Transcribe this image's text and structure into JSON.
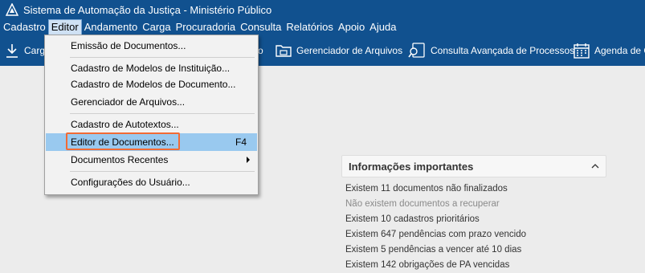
{
  "window": {
    "title": "Sistema de Automação da Justiça - Ministério Público"
  },
  "menu": [
    "Cadastro",
    "Editor",
    "Andamento",
    "Carga",
    "Procuradoria",
    "Consulta",
    "Relatórios",
    "Apoio",
    "Ajuda"
  ],
  "toolbar": {
    "carga": "Carga",
    "hidden_suffix": "o",
    "gerenciador": "Gerenciador de Arquivos",
    "consulta": "Consulta Avançada de Processos",
    "agenda": "Agenda de C"
  },
  "editor_menu": {
    "emissao": "Emissão de Documentos...",
    "modelos_instituicao": "Cadastro de Modelos de Instituição...",
    "modelos_documento": "Cadastro de Modelos de Documento...",
    "gerenciador": "Gerenciador de Arquivos...",
    "autotextos": "Cadastro de Autotextos...",
    "editor_documentos": "Editor de Documentos...",
    "editor_shortcut": "F4",
    "recentes": "Documentos Recentes",
    "configuracoes": "Configurações do Usuário..."
  },
  "info_panel": {
    "title": "Informações importantes",
    "lines": [
      "Existem 11 documentos não finalizados",
      "Não existem documentos a recuperar",
      "Existem 10 cadastros prioritários",
      "Existem 647 pendências com prazo vencido",
      "Existem 5 pendências a vencer até 10 dias",
      "Existem 142 obrigações de PA vencidas"
    ]
  }
}
